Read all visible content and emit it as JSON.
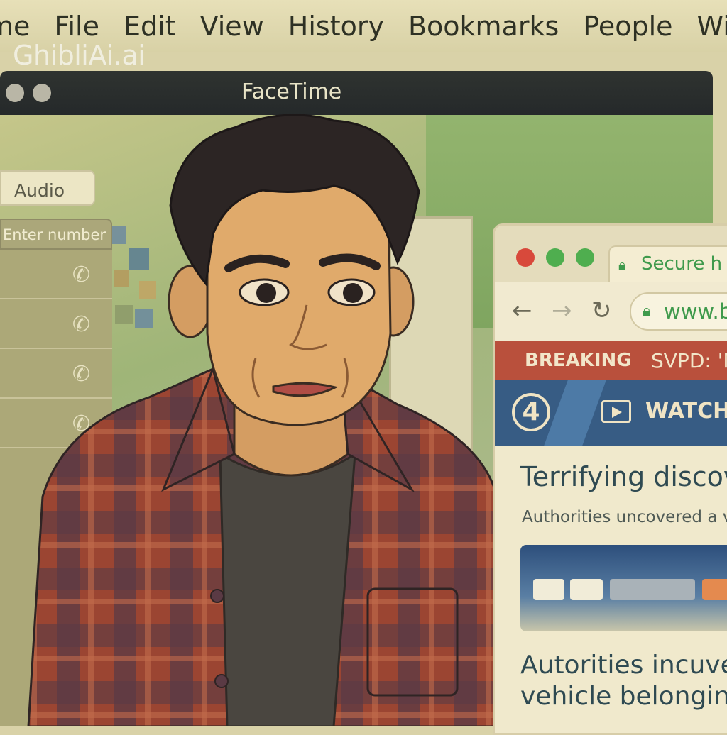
{
  "menubar": {
    "items": [
      "me",
      "File",
      "Edit",
      "View",
      "History",
      "Bookmarks",
      "People",
      "Wir"
    ]
  },
  "watermark": "GhibliAi.ai",
  "facetime": {
    "title": "FaceTime",
    "audio_label": "Audio",
    "number_placeholder": "Enter number",
    "call_rows": [
      "phone-icon",
      "phone-icon",
      "phone-icon",
      "phone-icon"
    ]
  },
  "browser": {
    "tab_label": "Secure h",
    "url": "www.b",
    "breaking_label": "BREAKING",
    "breaking_text": "SVPD: 'N",
    "channel_logo": "4",
    "watch_label": "WATCH",
    "headline": "Terrifying discov",
    "subhead": "Authorities uncovered a v",
    "headline2_line1": "Autorities incuver",
    "headline2_line2": "vehicle belonging"
  },
  "colors": {
    "secure_green": "#3f9a4c",
    "breaking_red": "#b9503c",
    "news_blue": "#375c84",
    "traffic_red": "#d8493b",
    "traffic_green": "#4fae4f"
  }
}
